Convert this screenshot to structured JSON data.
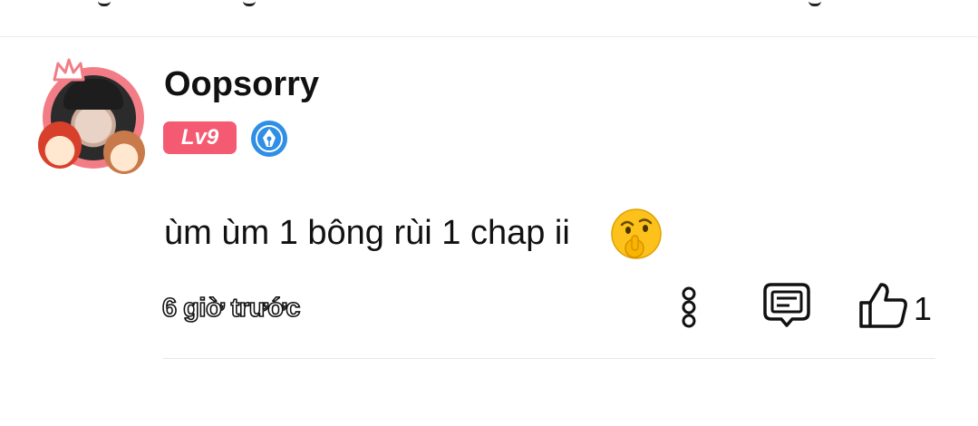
{
  "comment": {
    "username": "Oopsorry",
    "level_badge": "Lv9",
    "text": "ùm ùm 1 bông rùi 1 chap ii",
    "emoji": "shushing-face-emoji",
    "timestamp": "6 giờ trước",
    "like_count": "1"
  },
  "icons": {
    "more": "more-vertical-icon",
    "reply": "reply-comment-icon",
    "like": "thumbs-up-icon",
    "author_badge": "pen-nib-badge-icon"
  },
  "colors": {
    "level_badge": "#f45a72",
    "avatar_frame": "#f27d86",
    "author_badge": "#2f8ee6",
    "text": "#111111",
    "divider": "#e6e6e6"
  }
}
